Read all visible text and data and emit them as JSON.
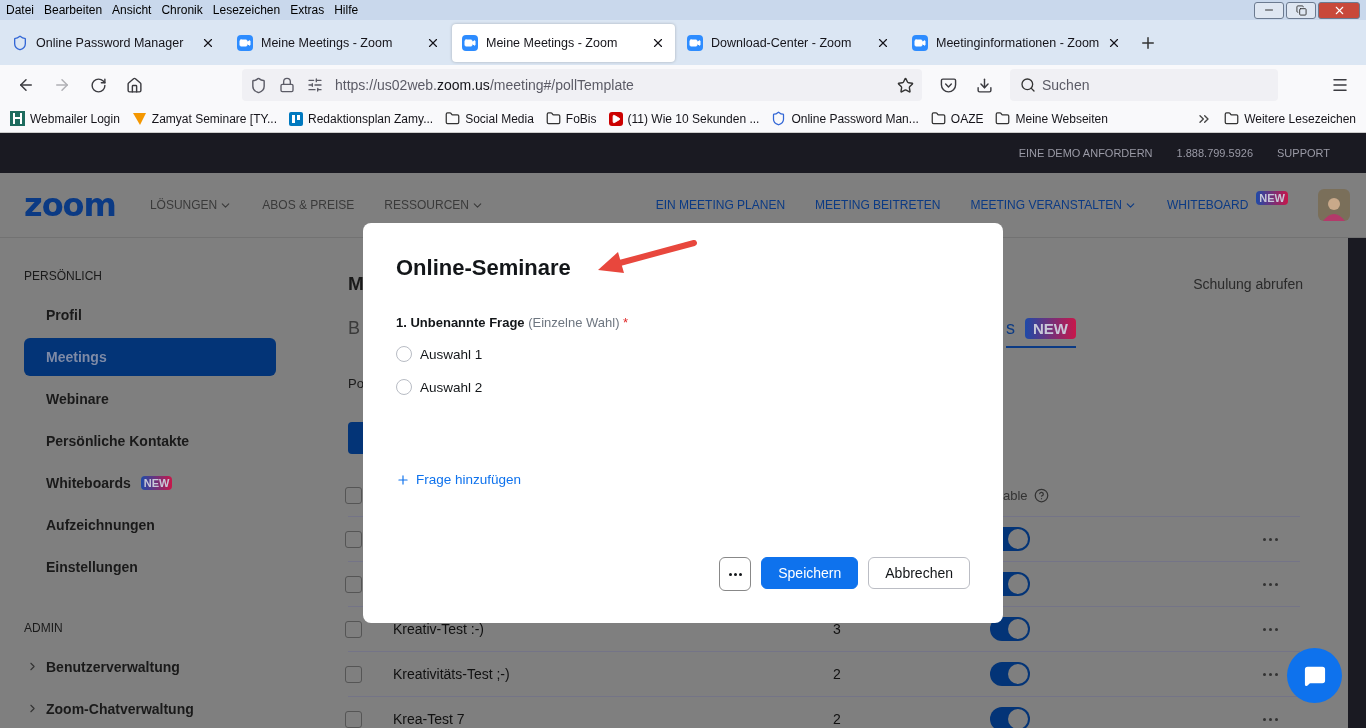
{
  "menu_bar": [
    "Datei",
    "Bearbeiten",
    "Ansicht",
    "Chronik",
    "Lesezeichen",
    "Extras",
    "Hilfe"
  ],
  "browser_tabs": [
    {
      "title": "Online Password Manager",
      "kind": "password",
      "selected": false
    },
    {
      "title": "Meine Meetings - Zoom",
      "kind": "zoom",
      "selected": false
    },
    {
      "title": "Meine Meetings - Zoom",
      "kind": "zoom",
      "selected": true
    },
    {
      "title": "Download-Center - Zoom",
      "kind": "zoom",
      "selected": false
    },
    {
      "title": "Meetinginformationen - Zoom",
      "kind": "zoom",
      "selected": false
    }
  ],
  "address_bar": {
    "url_prefix": "https://us02web.",
    "url_host": "zoom.us",
    "url_path": "/meeting#/pollTemplate"
  },
  "search": {
    "placeholder": "Suchen"
  },
  "bookmarks": [
    {
      "label": "Webmailer Login",
      "kind": "webmailer"
    },
    {
      "label": "Zamyat Seminare [TY...",
      "kind": "typo3"
    },
    {
      "label": "Redaktionsplan Zamy...",
      "kind": "board"
    },
    {
      "label": "Social Media",
      "kind": "folder"
    },
    {
      "label": "FoBis",
      "kind": "folder"
    },
    {
      "label": "(11) Wie 10 Sekunden ...",
      "kind": "video"
    },
    {
      "label": "Online Password Man...",
      "kind": "password"
    },
    {
      "label": "OAZE",
      "kind": "folder"
    },
    {
      "label": "Meine Webseiten",
      "kind": "folder"
    }
  ],
  "more_bookmarks": "Weitere Lesezeichen",
  "top_strip": [
    "EINE DEMO ANFORDERN",
    "1.888.799.5926",
    "SUPPORT"
  ],
  "site_nav": {
    "logo": "zoom",
    "left_links": [
      {
        "label": "LÖSUNGEN",
        "dropdown": true
      },
      {
        "label": "ABOS & PREISE",
        "dropdown": false
      },
      {
        "label": "RESSOURCEN",
        "dropdown": true
      }
    ],
    "right_links": [
      {
        "label": "EIN MEETING PLANEN",
        "dropdown": false
      },
      {
        "label": "MEETING BEITRETEN",
        "dropdown": false
      },
      {
        "label": "MEETING VERANSTALTEN",
        "dropdown": true
      },
      {
        "label": "WHITEBOARD",
        "dropdown": false,
        "badge": "NEW"
      }
    ]
  },
  "sidebar": [
    {
      "heading": "PERSÖNLICH",
      "items": [
        {
          "label": "Profil",
          "selected": false,
          "expandable": false
        },
        {
          "label": "Meetings",
          "selected": true,
          "expandable": false
        },
        {
          "label": "Webinare",
          "selected": false,
          "expandable": false
        },
        {
          "label": "Persönliche Kontakte",
          "selected": false,
          "expandable": false
        },
        {
          "label": "Whiteboards",
          "selected": false,
          "expandable": false,
          "badge": "NEW"
        },
        {
          "label": "Aufzeichnungen",
          "selected": false,
          "expandable": false
        },
        {
          "label": "Einstellungen",
          "selected": false,
          "expandable": false
        }
      ]
    },
    {
      "heading": "ADMIN",
      "items": [
        {
          "label": "Benutzerverwaltung",
          "selected": false,
          "expandable": true
        },
        {
          "label": "Zoom-Chatverwaltung",
          "selected": false,
          "expandable": true
        }
      ]
    }
  ],
  "main": {
    "heading": "M",
    "training_link": "Schulung abrufen",
    "tabs": [
      {
        "label": "B",
        "selected": false
      },
      {
        "label": "s",
        "selected": true,
        "badge": "NEW"
      }
    ],
    "intro": "Po",
    "table": {
      "header_checked": false,
      "column_4": "able",
      "rows": [
        {
          "checked": false,
          "enabled": true
        },
        {
          "checked": false,
          "enabled": true
        },
        {
          "name": "Kreativ-Test :-)",
          "count": "3",
          "checked": false,
          "enabled": true
        },
        {
          "name": "Kreativitäts-Test ;-)",
          "count": "2",
          "checked": false,
          "enabled": true
        },
        {
          "name": "Krea-Test 7",
          "count": "2",
          "checked": false,
          "enabled": true
        }
      ]
    }
  },
  "dialog": {
    "title": "Online-Seminare",
    "question": {
      "title": "1. Unbenannte Frage",
      "type": "(Einzelne Wahl)",
      "required": "*"
    },
    "choices": [
      {
        "label": "Auswahl 1",
        "selected": false
      },
      {
        "label": "Auswahl 2",
        "selected": false
      }
    ],
    "add_question": "Frage hinzufügen",
    "buttons": [
      {
        "label": "Speichern",
        "kind": "primary"
      },
      {
        "label": "Abbrechen",
        "kind": "secondary"
      }
    ]
  }
}
